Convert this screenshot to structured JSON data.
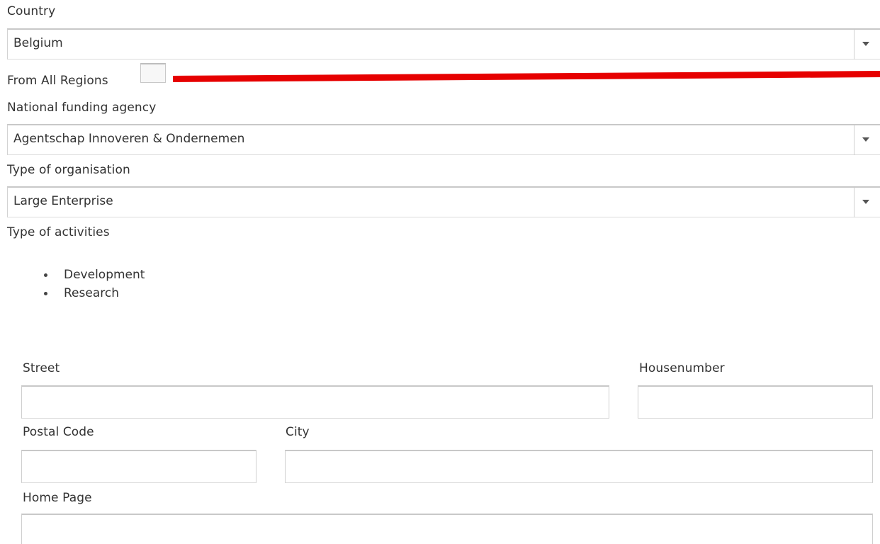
{
  "country": {
    "label": "Country",
    "selected": "Belgium"
  },
  "all_regions": {
    "label": "From All Regions",
    "checked": false,
    "annotation_color": "#e60000"
  },
  "funding_agency": {
    "label": "National funding agency",
    "selected": "Agentschap Innoveren & Ondernemen"
  },
  "organisation_type": {
    "label": "Type of organisation",
    "selected": "Large Enterprise"
  },
  "activities": {
    "label": "Type of activities",
    "items": [
      "Development",
      "Research"
    ]
  },
  "address": {
    "street_label": "Street",
    "street_value": "",
    "housenumber_label": "Housenumber",
    "housenumber_value": "",
    "postal_code_label": "Postal Code",
    "postal_code_value": "",
    "city_label": "City",
    "city_value": "",
    "home_page_label": "Home Page",
    "home_page_value": ""
  }
}
